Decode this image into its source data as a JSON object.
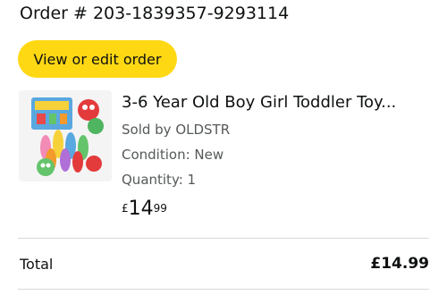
{
  "order": {
    "prefix": "Order #",
    "number": "203-1839357-9293114"
  },
  "actions": {
    "view_edit_label": "View or edit order"
  },
  "item": {
    "title": "3-6 Year Old Boy Girl Toddler Toy...",
    "sold_by": "Sold by OLDSTR",
    "condition": "Condition: New",
    "quantity": "Quantity: 1",
    "price": {
      "symbol": "£",
      "whole": "14",
      "fraction": "99"
    },
    "thumbnail_icon": "toy-bowling-set-image"
  },
  "summary": {
    "total_label": "Total",
    "total_value": "£14.99"
  },
  "colors": {
    "button": "#ffd814",
    "text": "#0f1111",
    "secondary_text": "#565959",
    "divider": "#d5d9d9"
  }
}
